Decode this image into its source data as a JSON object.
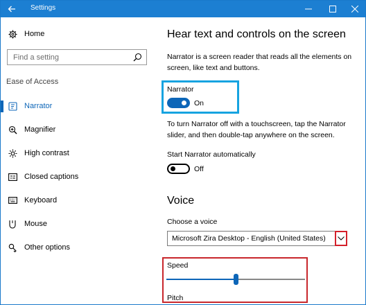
{
  "window": {
    "title": "Settings",
    "controls": {
      "minimize": "—",
      "maximize": "☐",
      "close": "✕"
    }
  },
  "sidebar": {
    "home_label": "Home",
    "search_placeholder": "Find a setting",
    "section_label": "Ease of Access",
    "items": [
      {
        "label": "Narrator",
        "icon": "narrator-icon",
        "selected": true
      },
      {
        "label": "Magnifier",
        "icon": "magnifier-icon",
        "selected": false
      },
      {
        "label": "High contrast",
        "icon": "high-contrast-icon",
        "selected": false
      },
      {
        "label": "Closed captions",
        "icon": "closed-captions-icon",
        "selected": false
      },
      {
        "label": "Keyboard",
        "icon": "keyboard-icon",
        "selected": false
      },
      {
        "label": "Mouse",
        "icon": "mouse-icon",
        "selected": false
      },
      {
        "label": "Other options",
        "icon": "other-options-icon",
        "selected": false
      }
    ]
  },
  "main": {
    "heading": "Hear text and controls on the screen",
    "intro": "Narrator is a screen reader that reads all the elements on screen, like text and buttons.",
    "narrator_toggle": {
      "label": "Narrator",
      "state": "On",
      "on": true
    },
    "touch_hint": "To turn Narrator off with a touchscreen, tap the Narrator slider, and then double-tap anywhere on the screen.",
    "auto_start": {
      "label": "Start Narrator automatically",
      "state": "Off",
      "on": false
    },
    "voice_heading": "Voice",
    "voice_select": {
      "label": "Choose a voice",
      "value": "Microsoft Zira Desktop - English (United States)"
    },
    "speed": {
      "label": "Speed",
      "value_fraction": 0.5
    },
    "pitch": {
      "label": "Pitch"
    }
  },
  "colors": {
    "titlebar": "#1c7fd2",
    "accent": "#0d66b8",
    "highlight_blue": "#16a3e0",
    "highlight_red": "#c8262b"
  }
}
